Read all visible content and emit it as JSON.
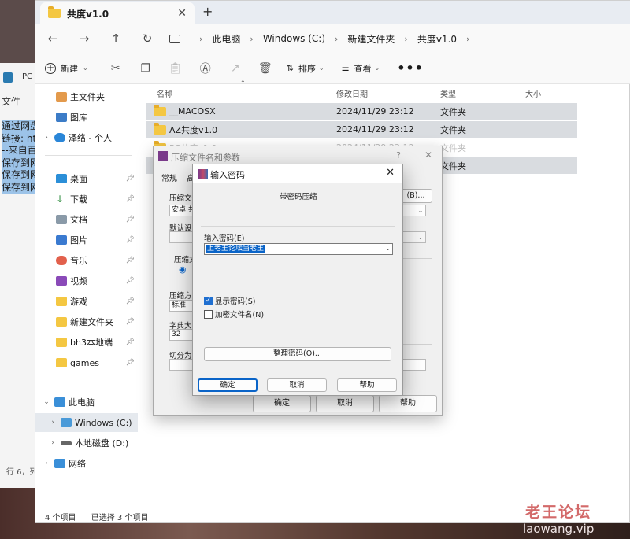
{
  "explorer": {
    "tab_title": "共度v1.0",
    "tab_close": "✕",
    "new_tab": "+",
    "nav": {
      "back": "←",
      "forward": "→",
      "up": "↑",
      "refresh": "↻"
    },
    "breadcrumbs": [
      "此电脑",
      "Windows (C:)",
      "新建文件夹",
      "共度v1.0"
    ],
    "toolbar": {
      "new_label": "新建",
      "sort_label": "排序",
      "view_label": "查看",
      "more": "•••"
    },
    "sidebar": {
      "home": "主文件夹",
      "gallery": "图库",
      "onedrive": "泽络 - 个人",
      "desktop": "桌面",
      "downloads": "下载",
      "documents": "文档",
      "pictures": "图片",
      "music": "音乐",
      "videos": "视频",
      "games_cn": "游戏",
      "new_folder": "新建文件夹",
      "bh3": "bh3本地端",
      "games": "games",
      "this_pc": "此电脑",
      "drive_c": "Windows (C:)",
      "drive_d": "本地磁盘 (D:)",
      "network": "网络"
    },
    "columns": {
      "name": "名称",
      "date": "修改日期",
      "type": "类型",
      "size": "大小"
    },
    "files": [
      {
        "name": "__MACOSX",
        "date": "2024/11/29 23:12",
        "type": "文件夹"
      },
      {
        "name": "AZ共度v1.0",
        "date": "2024/11/29 23:12",
        "type": "文件夹"
      },
      {
        "name": "PC共度v1.0",
        "date": "2024/11/29 23:12",
        "type": "文件夹"
      },
      {
        "name": "",
        "date": "",
        "type": "文件夹"
      }
    ],
    "status": {
      "count": "4 个项目",
      "selected": "已选择 3 个项目"
    }
  },
  "notepad": {
    "tab": "PC",
    "menu": "文件",
    "lines": [
      "通过网盘",
      "链接: htt",
      "--来自百",
      "保存到网",
      "保存到网",
      "保存到网"
    ],
    "status": "行 6，列"
  },
  "params_dialog": {
    "title": "压缩文件名和参数",
    "help_q": "?",
    "close": "✕",
    "tab_general": "常规",
    "tab_advanced": "高",
    "archive_name_label": "压缩文件",
    "archive_name_value": "安卓 共",
    "browse_btn": "(B)...",
    "default_settings_label": "默认设置",
    "format_label": "压缩文",
    "method_label": "压缩方式",
    "method_value": "标准",
    "dict_label": "字典大小",
    "dict_value": "32",
    "split_label": "切分为分",
    "ok": "确定",
    "cancel": "取消",
    "help": "帮助"
  },
  "password_dialog": {
    "title": "输入密码",
    "close": "✕",
    "section_title": "带密码压缩",
    "enter_label": "输入密码(E)",
    "password_value": "上老王论坛当老王",
    "show_password": "显示密码(S)",
    "show_password_checked": true,
    "encrypt_names": "加密文件名(N)",
    "encrypt_names_checked": false,
    "manage_btn": "整理密码(O)...",
    "ok": "确定",
    "cancel": "取消",
    "help": "帮助"
  },
  "watermark": {
    "line1": "老王论坛",
    "line2": "laowang.vip"
  },
  "colors": {
    "accent": "#0a64c8",
    "folder": "#f4c742",
    "selection_row": "#d9dce0"
  }
}
